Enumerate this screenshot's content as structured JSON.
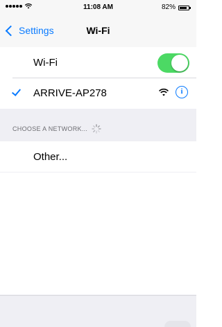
{
  "status_bar": {
    "time": "11:08 AM",
    "battery_text": "82%",
    "battery_level": 0.82
  },
  "nav": {
    "back_label": "Settings",
    "title": "Wi-Fi"
  },
  "wifi_row": {
    "label": "Wi-Fi",
    "enabled": true
  },
  "connected_network": {
    "name": "ARRIVE-AP278"
  },
  "section_header": "CHOOSE A NETWORK...",
  "other_row": {
    "label": "Other..."
  },
  "colors": {
    "accent": "#0a7bff",
    "toggle_on": "#4cd964",
    "background": "#efeff4"
  }
}
